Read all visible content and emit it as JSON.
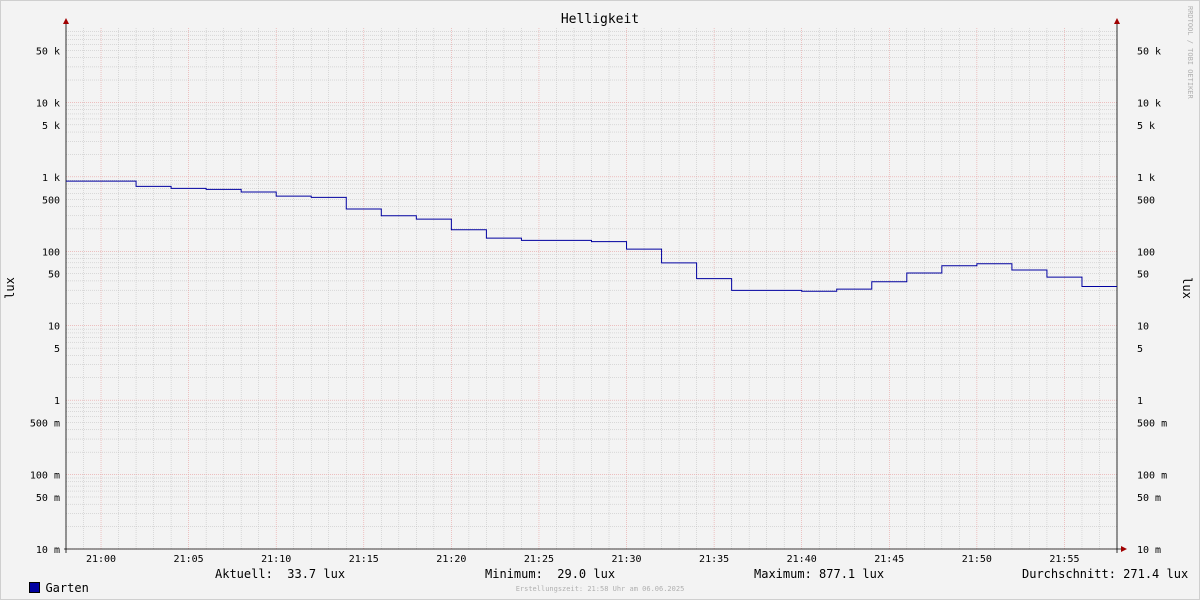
{
  "chart_data": {
    "type": "line",
    "title": "Helligkeit",
    "ylabel": "lux",
    "y_scale": "log",
    "ylim": [
      0.01,
      100000
    ],
    "y_ticks": [
      {
        "value": 50000,
        "label": "50 k"
      },
      {
        "value": 10000,
        "label": "10 k"
      },
      {
        "value": 5000,
        "label": "5 k"
      },
      {
        "value": 1000,
        "label": "1 k"
      },
      {
        "value": 500,
        "label": "500"
      },
      {
        "value": 100,
        "label": "100"
      },
      {
        "value": 50,
        "label": "50"
      },
      {
        "value": 10,
        "label": "10"
      },
      {
        "value": 5,
        "label": "5"
      },
      {
        "value": 1,
        "label": "1"
      },
      {
        "value": 0.5,
        "label": "500 m"
      },
      {
        "value": 0.1,
        "label": "100 m"
      },
      {
        "value": 0.05,
        "label": "50 m"
      },
      {
        "value": 0.01,
        "label": "10 m"
      }
    ],
    "xlim": [
      "20:58",
      "21:58"
    ],
    "x_ticks": [
      "21:00",
      "21:05",
      "21:10",
      "21:15",
      "21:20",
      "21:25",
      "21:30",
      "21:35",
      "21:40",
      "21:45",
      "21:50",
      "21:55"
    ],
    "grid": true,
    "series": [
      {
        "name": "Garten",
        "color": "#0000a0",
        "x": [
          "20:58",
          "21:00",
          "21:02",
          "21:04",
          "21:06",
          "21:08",
          "21:10",
          "21:12",
          "21:14",
          "21:16",
          "21:18",
          "21:20",
          "21:22",
          "21:24",
          "21:26",
          "21:28",
          "21:30",
          "21:32",
          "21:34",
          "21:36",
          "21:38",
          "21:40",
          "21:42",
          "21:44",
          "21:46",
          "21:48",
          "21:50",
          "21:52",
          "21:54",
          "21:56",
          "21:58"
        ],
        "values": [
          877.1,
          877.1,
          745,
          700,
          680,
          625,
          550,
          530,
          370,
          300,
          270,
          195,
          150,
          140,
          140,
          135,
          107,
          70,
          43,
          29.8,
          29.8,
          29,
          31,
          39,
          51,
          64,
          68,
          56,
          45,
          33.7,
          33.7
        ]
      }
    ]
  },
  "legend": {
    "series_label": "Garten",
    "series_color": "#0000a0",
    "current": "Aktuell:  33.7 lux",
    "minimum": "Minimum:  29.0 lux",
    "maximum": "Maximum: 877.1 lux",
    "average": "Durchschnitt: 271.4 lux"
  },
  "watermark": "RRDTOOL / TOBI OETIKER",
  "footer": "Erstellungszeit: 21:58 Uhr am 06.06.2025"
}
